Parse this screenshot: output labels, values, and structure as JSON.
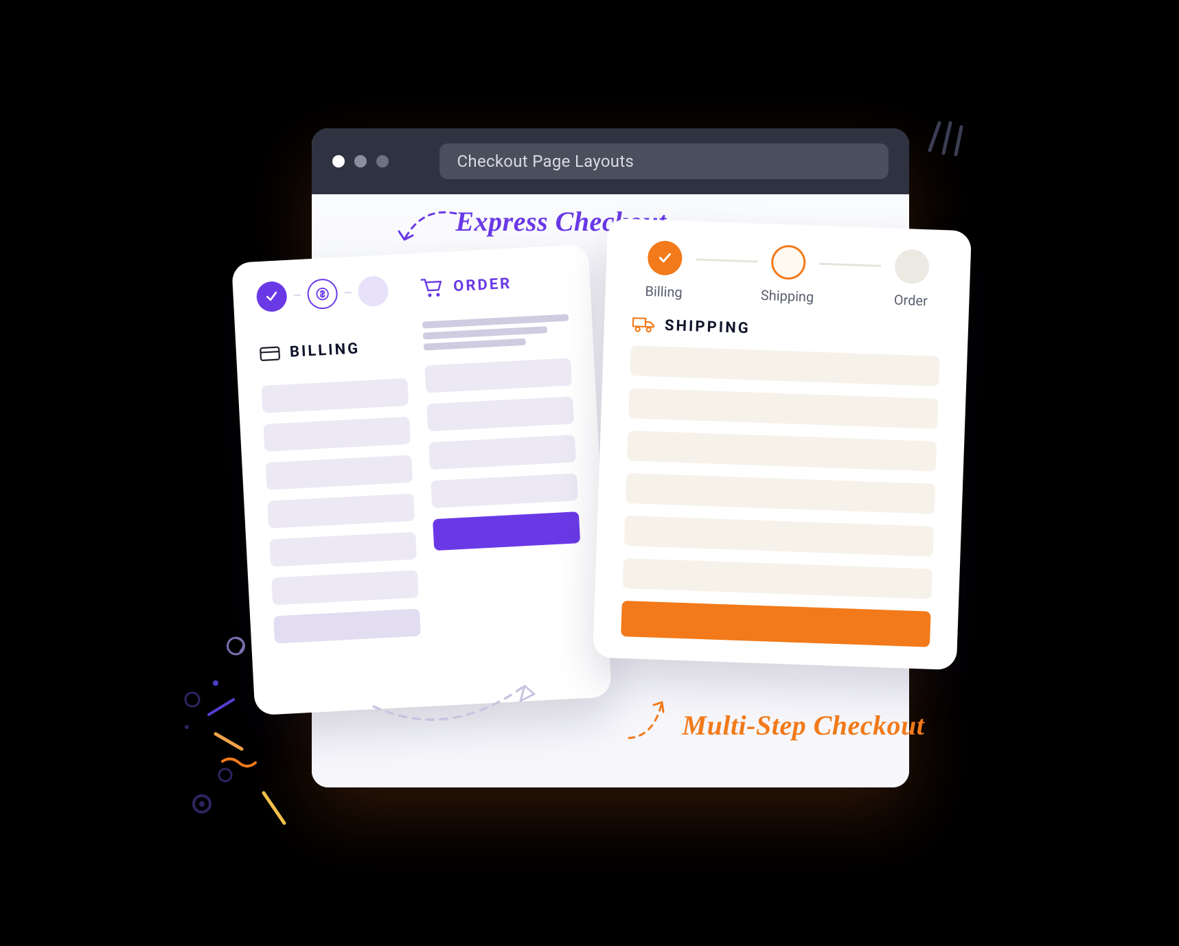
{
  "window": {
    "url_label": "Checkout Page Layouts"
  },
  "labels": {
    "express": "Express Checkout",
    "multi": "Multi-Step Checkout"
  },
  "express_card": {
    "order_heading": "ORDER",
    "billing_heading": "BILLING"
  },
  "multi_card": {
    "steps": {
      "billing": "Billing",
      "shipping": "Shipping",
      "order": "Order"
    },
    "section_heading": "SHIPPING"
  },
  "colors": {
    "purple": "#6a39e6",
    "orange": "#f27a1a"
  }
}
